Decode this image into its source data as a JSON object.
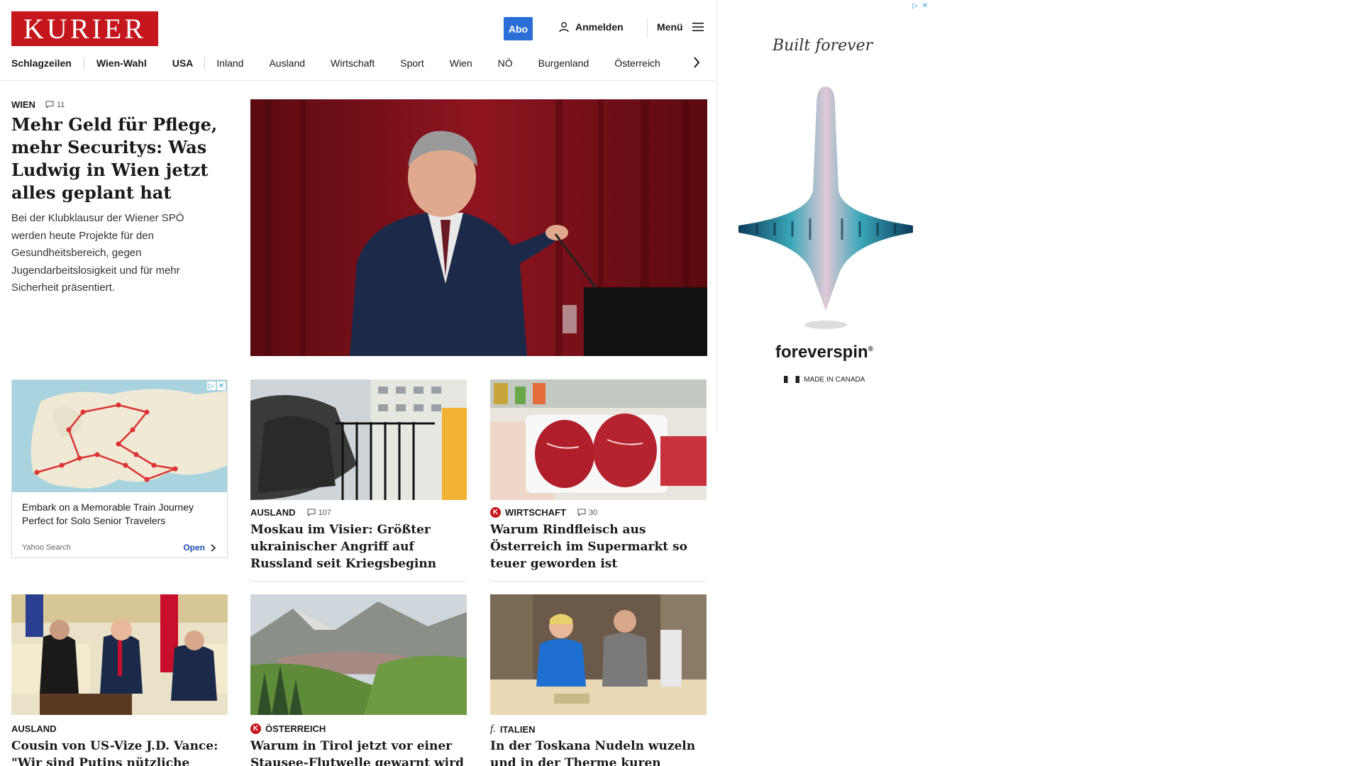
{
  "header": {
    "logo_text": "KURIER",
    "abo_label": "Abo",
    "login_label": "Anmelden",
    "menu_label": "Menü",
    "accent_color": "#c4161c",
    "abo_color": "#2b6fd6"
  },
  "nav": {
    "items": [
      "Schlagzeilen",
      "Wien-Wahl",
      "USA",
      "Inland",
      "Ausland",
      "Wirtschaft",
      "Sport",
      "Wien",
      "NÖ",
      "Burgenland",
      "Österreich"
    ]
  },
  "lead": {
    "kicker": "WIEN",
    "comments": "11",
    "title": "Mehr Geld für Pflege, mehr Securitys: Was Ludwig in Wien jetzt alles geplant hat",
    "teaser": "Bei der Klubklausur der Wiener SPÖ werden heute Projekte für den Gesundheitsbereich, gegen Jugendarbeitslosigkeit und für mehr Sicherheit präsentiert."
  },
  "native_ad": {
    "title": "Embark on a Memorable Train Journey Perfect for Solo Senior Travelers",
    "source": "Yahoo Search",
    "cta": "Open"
  },
  "cards": [
    {
      "kicker": "AUSLAND",
      "comments": "107",
      "title": "Moskau im Visier: Größter ukrainischer Angriff auf Russland seit Kriegsbeginn"
    },
    {
      "kicker": "WIRTSCHAFT",
      "badge": "K",
      "comments": "30",
      "title": "Warum Rindfleisch aus Österreich im Supermarkt so teuer geworden ist"
    },
    {
      "kicker": "AUSLAND",
      "title": "Cousin von US-Vize J.D. Vance: \"Wir sind Putins nützliche Idioten\""
    },
    {
      "kicker": "ÖSTERREICH",
      "badge": "K",
      "title": "Warum in Tirol jetzt vor einer Stausee-Flutwelle gewarnt wird"
    },
    {
      "kicker": "ITALIEN",
      "badge": "f.",
      "title": "In der Toskana Nudeln wuzeln und in der Therme kuren"
    }
  ],
  "right_ad": {
    "tagline": "Built forever",
    "brand": "foreverspin",
    "made": "MADE IN CANADA"
  },
  "icons": {
    "login": "user-icon",
    "menu": "hamburger-icon",
    "nav_next": "chevron-right-icon",
    "comments": "comment-icon"
  }
}
